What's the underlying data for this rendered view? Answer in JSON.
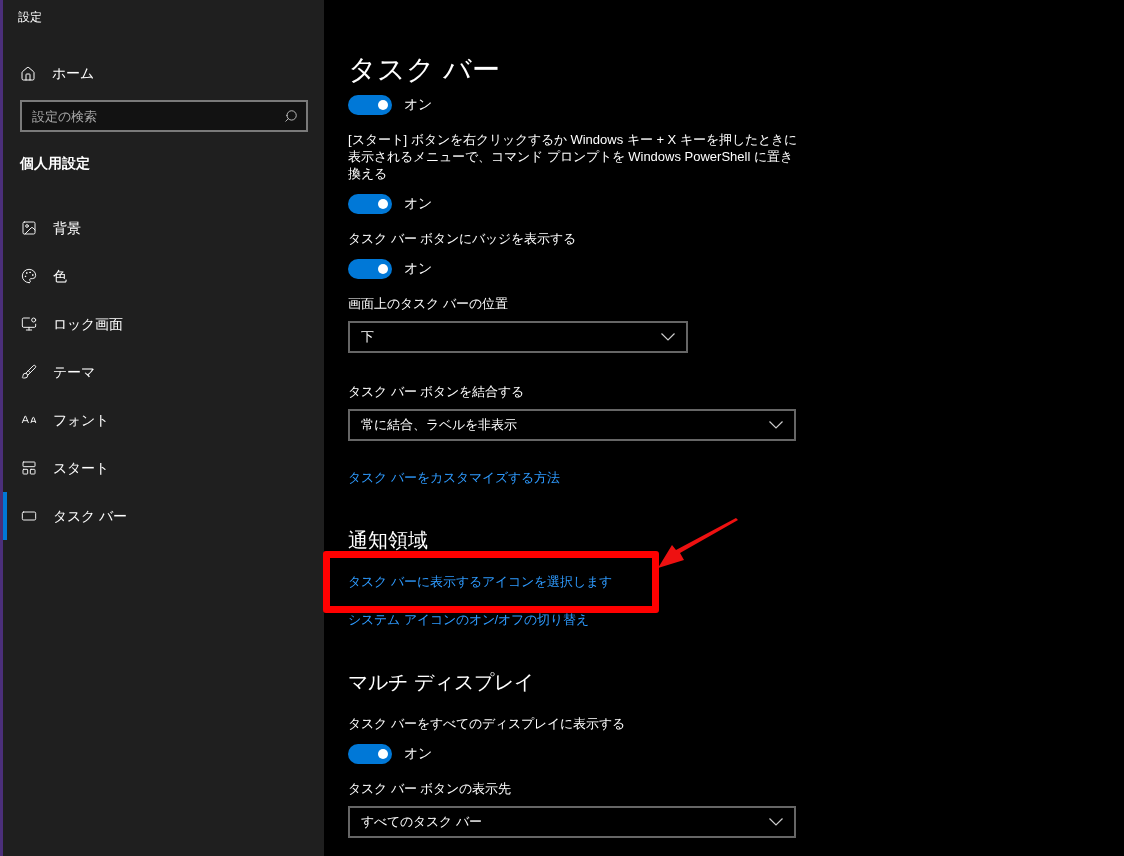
{
  "window": {
    "title": "設定"
  },
  "sidebar": {
    "home": "ホーム",
    "search": {
      "placeholder": "設定の検索"
    },
    "section": "個人用設定",
    "items": [
      {
        "label": "背景",
        "selected": false
      },
      {
        "label": "色",
        "selected": false
      },
      {
        "label": "ロック画面",
        "selected": false
      },
      {
        "label": "テーマ",
        "selected": false
      },
      {
        "label": "フォント",
        "selected": false
      },
      {
        "label": "スタート",
        "selected": false
      },
      {
        "label": "タスク バー",
        "selected": true
      }
    ]
  },
  "content": [
    {
      "kind": "title",
      "text": "タスク バー"
    },
    {
      "kind": "toggle",
      "on": true,
      "text": "オン"
    },
    {
      "kind": "label",
      "text": "[スタート] ボタンを右クリックするか Windows キー + X キーを押したときに表示されるメニューで、コマンド プロンプトを Windows PowerShell に置き換える"
    },
    {
      "kind": "toggle",
      "on": true,
      "text": "オン"
    },
    {
      "kind": "label",
      "text": "タスク バー ボタンにバッジを表示する"
    },
    {
      "kind": "toggle",
      "on": true,
      "text": "オン"
    },
    {
      "kind": "label",
      "text": "画面上のタスク バーの位置"
    },
    {
      "kind": "dropdown",
      "text": "下",
      "wide": false
    },
    {
      "kind": "label",
      "text": "タスク バー ボタンを結合する"
    },
    {
      "kind": "dropdown",
      "text": "常に結合、ラベルを非表示",
      "wide": true
    },
    {
      "kind": "link",
      "text": "タスク バーをカスタマイズする方法",
      "annotated": false
    },
    {
      "kind": "heading",
      "text": "通知領域"
    },
    {
      "kind": "link",
      "text": "タスク バーに表示するアイコンを選択します",
      "annotated": true
    },
    {
      "kind": "link",
      "text": "システム アイコンのオン/オフの切り替え",
      "annotated": false
    },
    {
      "kind": "heading",
      "text": "マルチ ディスプレイ"
    },
    {
      "kind": "label",
      "text": "タスク バーをすべてのディスプレイに表示する"
    },
    {
      "kind": "toggle",
      "on": true,
      "text": "オン"
    },
    {
      "kind": "label",
      "text": "タスク バー ボタンの表示先"
    },
    {
      "kind": "dropdown",
      "text": "すべてのタスク バー",
      "wide": true
    }
  ]
}
